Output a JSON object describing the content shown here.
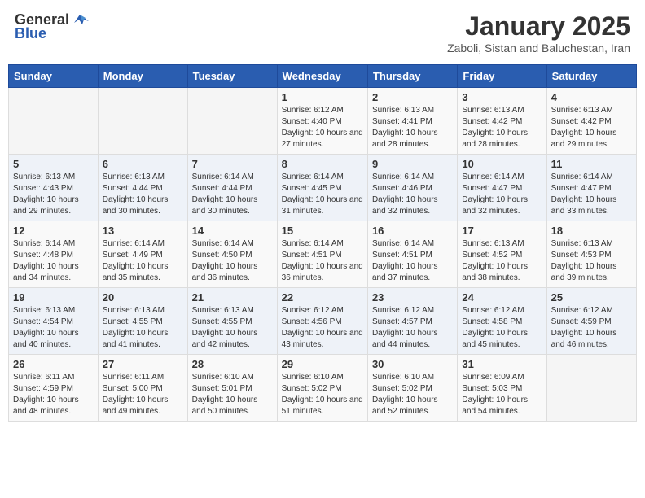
{
  "logo": {
    "general": "General",
    "blue": "Blue"
  },
  "header": {
    "month": "January 2025",
    "location": "Zaboli, Sistan and Baluchestan, Iran"
  },
  "days_of_week": [
    "Sunday",
    "Monday",
    "Tuesday",
    "Wednesday",
    "Thursday",
    "Friday",
    "Saturday"
  ],
  "weeks": [
    [
      {
        "day": "",
        "info": ""
      },
      {
        "day": "",
        "info": ""
      },
      {
        "day": "",
        "info": ""
      },
      {
        "day": "1",
        "info": "Sunrise: 6:12 AM\nSunset: 4:40 PM\nDaylight: 10 hours and 27 minutes."
      },
      {
        "day": "2",
        "info": "Sunrise: 6:13 AM\nSunset: 4:41 PM\nDaylight: 10 hours and 28 minutes."
      },
      {
        "day": "3",
        "info": "Sunrise: 6:13 AM\nSunset: 4:42 PM\nDaylight: 10 hours and 28 minutes."
      },
      {
        "day": "4",
        "info": "Sunrise: 6:13 AM\nSunset: 4:42 PM\nDaylight: 10 hours and 29 minutes."
      }
    ],
    [
      {
        "day": "5",
        "info": "Sunrise: 6:13 AM\nSunset: 4:43 PM\nDaylight: 10 hours and 29 minutes."
      },
      {
        "day": "6",
        "info": "Sunrise: 6:13 AM\nSunset: 4:44 PM\nDaylight: 10 hours and 30 minutes."
      },
      {
        "day": "7",
        "info": "Sunrise: 6:14 AM\nSunset: 4:44 PM\nDaylight: 10 hours and 30 minutes."
      },
      {
        "day": "8",
        "info": "Sunrise: 6:14 AM\nSunset: 4:45 PM\nDaylight: 10 hours and 31 minutes."
      },
      {
        "day": "9",
        "info": "Sunrise: 6:14 AM\nSunset: 4:46 PM\nDaylight: 10 hours and 32 minutes."
      },
      {
        "day": "10",
        "info": "Sunrise: 6:14 AM\nSunset: 4:47 PM\nDaylight: 10 hours and 32 minutes."
      },
      {
        "day": "11",
        "info": "Sunrise: 6:14 AM\nSunset: 4:47 PM\nDaylight: 10 hours and 33 minutes."
      }
    ],
    [
      {
        "day": "12",
        "info": "Sunrise: 6:14 AM\nSunset: 4:48 PM\nDaylight: 10 hours and 34 minutes."
      },
      {
        "day": "13",
        "info": "Sunrise: 6:14 AM\nSunset: 4:49 PM\nDaylight: 10 hours and 35 minutes."
      },
      {
        "day": "14",
        "info": "Sunrise: 6:14 AM\nSunset: 4:50 PM\nDaylight: 10 hours and 36 minutes."
      },
      {
        "day": "15",
        "info": "Sunrise: 6:14 AM\nSunset: 4:51 PM\nDaylight: 10 hours and 36 minutes."
      },
      {
        "day": "16",
        "info": "Sunrise: 6:14 AM\nSunset: 4:51 PM\nDaylight: 10 hours and 37 minutes."
      },
      {
        "day": "17",
        "info": "Sunrise: 6:13 AM\nSunset: 4:52 PM\nDaylight: 10 hours and 38 minutes."
      },
      {
        "day": "18",
        "info": "Sunrise: 6:13 AM\nSunset: 4:53 PM\nDaylight: 10 hours and 39 minutes."
      }
    ],
    [
      {
        "day": "19",
        "info": "Sunrise: 6:13 AM\nSunset: 4:54 PM\nDaylight: 10 hours and 40 minutes."
      },
      {
        "day": "20",
        "info": "Sunrise: 6:13 AM\nSunset: 4:55 PM\nDaylight: 10 hours and 41 minutes."
      },
      {
        "day": "21",
        "info": "Sunrise: 6:13 AM\nSunset: 4:55 PM\nDaylight: 10 hours and 42 minutes."
      },
      {
        "day": "22",
        "info": "Sunrise: 6:12 AM\nSunset: 4:56 PM\nDaylight: 10 hours and 43 minutes."
      },
      {
        "day": "23",
        "info": "Sunrise: 6:12 AM\nSunset: 4:57 PM\nDaylight: 10 hours and 44 minutes."
      },
      {
        "day": "24",
        "info": "Sunrise: 6:12 AM\nSunset: 4:58 PM\nDaylight: 10 hours and 45 minutes."
      },
      {
        "day": "25",
        "info": "Sunrise: 6:12 AM\nSunset: 4:59 PM\nDaylight: 10 hours and 46 minutes."
      }
    ],
    [
      {
        "day": "26",
        "info": "Sunrise: 6:11 AM\nSunset: 4:59 PM\nDaylight: 10 hours and 48 minutes."
      },
      {
        "day": "27",
        "info": "Sunrise: 6:11 AM\nSunset: 5:00 PM\nDaylight: 10 hours and 49 minutes."
      },
      {
        "day": "28",
        "info": "Sunrise: 6:10 AM\nSunset: 5:01 PM\nDaylight: 10 hours and 50 minutes."
      },
      {
        "day": "29",
        "info": "Sunrise: 6:10 AM\nSunset: 5:02 PM\nDaylight: 10 hours and 51 minutes."
      },
      {
        "day": "30",
        "info": "Sunrise: 6:10 AM\nSunset: 5:02 PM\nDaylight: 10 hours and 52 minutes."
      },
      {
        "day": "31",
        "info": "Sunrise: 6:09 AM\nSunset: 5:03 PM\nDaylight: 10 hours and 54 minutes."
      },
      {
        "day": "",
        "info": ""
      }
    ]
  ]
}
